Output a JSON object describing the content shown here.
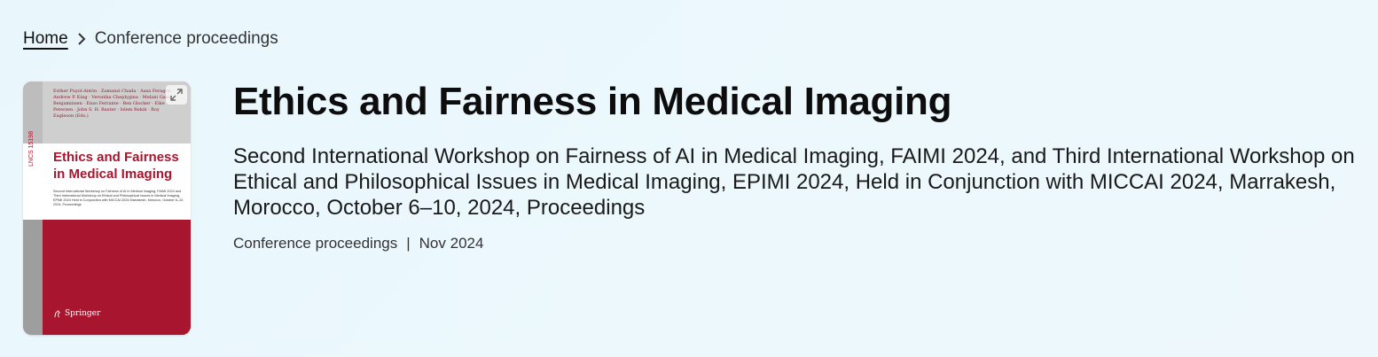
{
  "breadcrumb": {
    "home": "Home",
    "current": "Conference proceedings"
  },
  "cover": {
    "authors": "Esther Puyol-Antón · Zamanzi Chada · Aasa Feragen · Andrew P. King · Veronika Cheplygina · Melani Ganz-Benjaminsen · Enzo Ferrante · Ben Glocker · Eike Petersen · John S. H. Baxter · Islem Rekik · Roy Eagleson (Eds.)",
    "series": "LNCS 15198",
    "title": "Ethics and Fairness in Medical Imaging",
    "subtitle": "Second International Workshop on Fairness of AI in Medical Imaging, FAIMI 2024 and Third International Workshop on Ethical and Philosophical Issues in Medical Imaging, EPIMI 2024 Held in Conjunction with MICCAI 2024 Marrakesh, Morocco, October 6–10, 2024, Proceedings",
    "publisher": "Springer",
    "expand_icon": "expand-icon",
    "accent_color": "#a8152e"
  },
  "book": {
    "title": "Ethics and Fairness in Medical Imaging",
    "subtitle": "Second International Workshop on Fairness of AI in Medical Imaging, FAIMI 2024, and Third International Workshop on Ethical and Philosophical Issues in Medical Imaging, EPIMI 2024, Held in Conjunction with MICCAI 2024, Marrakesh, Morocco, October 6–10, 2024, Proceedings",
    "type": "Conference proceedings",
    "separator": "|",
    "date": "Nov 2024"
  }
}
